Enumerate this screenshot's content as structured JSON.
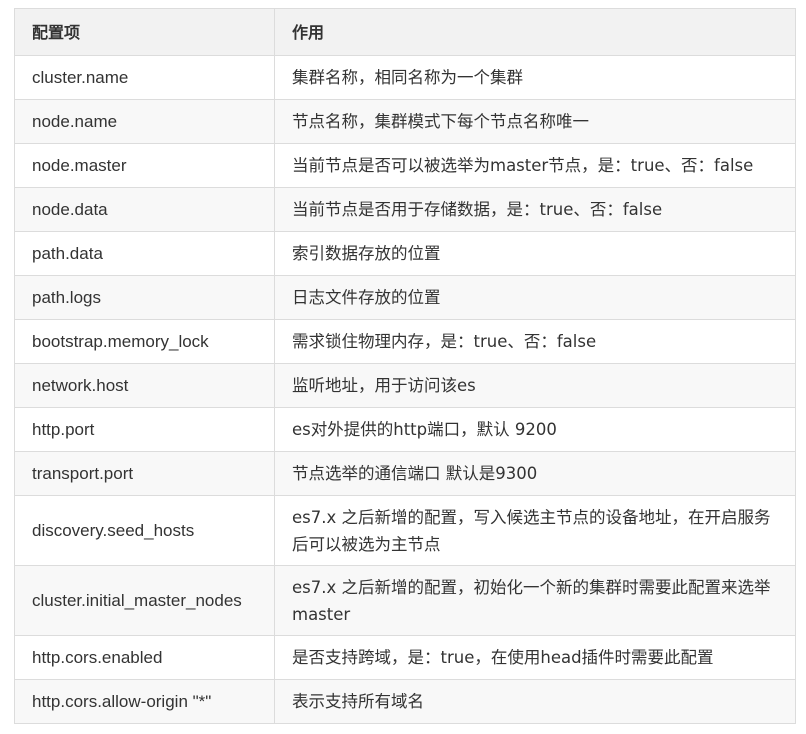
{
  "table": {
    "headers": [
      "配置项",
      "作用"
    ],
    "rows": [
      [
        "cluster.name",
        "集群名称，相同名称为一个集群"
      ],
      [
        "node.name",
        "节点名称，集群模式下每个节点名称唯一"
      ],
      [
        "node.master",
        "当前节点是否可以被选举为master节点，是：true、否：false"
      ],
      [
        "node.data",
        "当前节点是否用于存储数据，是：true、否：false"
      ],
      [
        "path.data",
        "索引数据存放的位置"
      ],
      [
        "path.logs",
        "日志文件存放的位置"
      ],
      [
        "bootstrap.memory_lock",
        "需求锁住物理内存，是：true、否：false"
      ],
      [
        "network.host",
        "监听地址，用于访问该es"
      ],
      [
        "http.port",
        "es对外提供的http端口，默认 9200"
      ],
      [
        "transport.port",
        "节点选举的通信端口 默认是9300"
      ],
      [
        "discovery.seed_hosts",
        "es7.x 之后新增的配置，写入候选主节点的设备地址，在开启服务后可以被选为主节点"
      ],
      [
        "cluster.initial_master_nodes",
        "es7.x 之后新增的配置，初始化一个新的集群时需要此配置来选举master"
      ],
      [
        "http.cors.enabled",
        "是否支持跨域，是：true，在使用head插件时需要此配置"
      ],
      [
        "http.cors.allow-origin \"*\"",
        "表示支持所有域名"
      ]
    ]
  }
}
